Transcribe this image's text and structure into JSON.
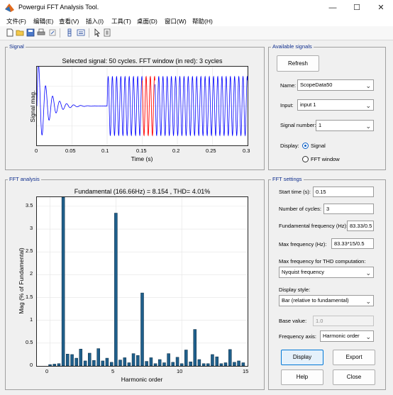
{
  "window": {
    "title": "Powergui FFT Analysis Tool.",
    "minimize_icon": "minimize-icon",
    "maximize_icon": "maximize-icon",
    "close_icon": "close-icon"
  },
  "menu": [
    "文件(F)",
    "编辑(E)",
    "查看(V)",
    "插入(I)",
    "工具(T)",
    "桌面(D)",
    "窗口(W)",
    "帮助(H)"
  ],
  "toolbar_icons": [
    "new-file-icon",
    "open-folder-icon",
    "save-icon",
    "print-icon",
    "link-icon",
    "colorbar-icon",
    "legend-icon",
    "pointer-icon",
    "property-inspector-icon"
  ],
  "signal_panel": {
    "title": "Signal",
    "plot_title": "Selected signal: 50 cycles. FFT window (in red): 3 cycles",
    "ylabel": "Signal mag.",
    "xlabel": "Time (s)",
    "x_ticks": [
      "0",
      "0.05",
      "0.1",
      "0.15",
      "0.2",
      "0.25",
      "0.3"
    ]
  },
  "fft_panel": {
    "title": "FFT analysis",
    "plot_title": "Fundamental (166.66Hz) = 8.154 , THD= 4.01%",
    "ylabel": "Mag (% of Fundamental)",
    "xlabel": "Harmonic order",
    "x_ticks": [
      "0",
      "5",
      "10",
      "15"
    ],
    "y_ticks": [
      "0",
      "0.5",
      "1",
      "1.5",
      "2",
      "2.5",
      "3",
      "3.5"
    ]
  },
  "chart_data": [
    {
      "type": "line",
      "title": "Selected signal: 50 cycles. FFT window (in red): 3 cycles",
      "xlabel": "Time (s)",
      "ylabel": "Signal mag.",
      "xlim": [
        0,
        0.3
      ],
      "grid": true,
      "series": [
        {
          "name": "",
          "color": "#0000ff",
          "description": "decaying transient 0-0.1 s, then steady 166.66 Hz sinusoid from 0.1 s to 0.3 s"
        },
        {
          "name": "",
          "color": "#ff0000",
          "description": "FFT window from 0.15 s to 0.168 s (3 cycles)"
        }
      ]
    },
    {
      "type": "bar",
      "title": "Fundamental (166.66Hz) = 8.154 , THD= 4.01%",
      "xlabel": "Harmonic order",
      "ylabel": "Mag (% of Fundamental)",
      "xlim": [
        -1,
        15
      ],
      "ylim": [
        0,
        3.7
      ],
      "grid": true,
      "bar_color": "#1f5f8b",
      "x": [
        0,
        0.33,
        0.67,
        1,
        1.33,
        1.67,
        2,
        2.33,
        2.67,
        3,
        3.33,
        3.67,
        4,
        4.33,
        4.67,
        5,
        5.33,
        5.67,
        6,
        6.33,
        6.67,
        7,
        7.33,
        7.67,
        8,
        8.33,
        8.67,
        9,
        9.33,
        9.67,
        10,
        10.33,
        10.67,
        11,
        11.33,
        11.67,
        12,
        12.33,
        12.67,
        13,
        13.33,
        13.67,
        14,
        14.33,
        14.67
      ],
      "values": [
        0.03,
        0.04,
        0.05,
        3.7,
        0.26,
        0.25,
        0.17,
        0.37,
        0.11,
        0.28,
        0.12,
        0.38,
        0.11,
        0.17,
        0.08,
        3.35,
        0.13,
        0.18,
        0.07,
        0.27,
        0.23,
        1.6,
        0.1,
        0.18,
        0.05,
        0.14,
        0.07,
        0.27,
        0.08,
        0.19,
        0.05,
        0.35,
        0.09,
        0.8,
        0.14,
        0.05,
        0.05,
        0.25,
        0.2,
        0.05,
        0.07,
        0.36,
        0.08,
        0.11,
        0.07
      ]
    }
  ],
  "available_signals": {
    "title": "Available signals",
    "refresh_label": "Refresh",
    "name_label": "Name:",
    "name_value": "ScopeData50",
    "input_label": "Input:",
    "input_value": "input 1",
    "signal_number_label": "Signal number:",
    "signal_number_value": "1",
    "display_label": "Display:",
    "display_options": [
      "Signal",
      "FFT window"
    ],
    "display_selected": "Signal"
  },
  "fft_settings": {
    "title": "FFT settings",
    "start_time_label": "Start time (s):",
    "start_time_value": "0.15",
    "num_cycles_label": "Number of cycles:",
    "num_cycles_value": "3",
    "fund_freq_label": "Fundamental frequency (Hz):",
    "fund_freq_value": "83.33/0.5",
    "max_freq_label": "Max frequency (Hz):",
    "max_freq_value": "83.33*15/0.5",
    "thd_label": "Max frequency for THD computation:",
    "thd_value": "Nyquist frequency",
    "display_style_label": "Display style:",
    "display_style_value": "Bar (relative to fundamental)",
    "base_value_label": "Base value:",
    "base_value_value": "1.0",
    "freq_axis_label": "Frequency axis:",
    "freq_axis_value": "Harmonic order",
    "display_button": "Display",
    "export_button": "Export",
    "help_button": "Help",
    "close_button": "Close"
  }
}
